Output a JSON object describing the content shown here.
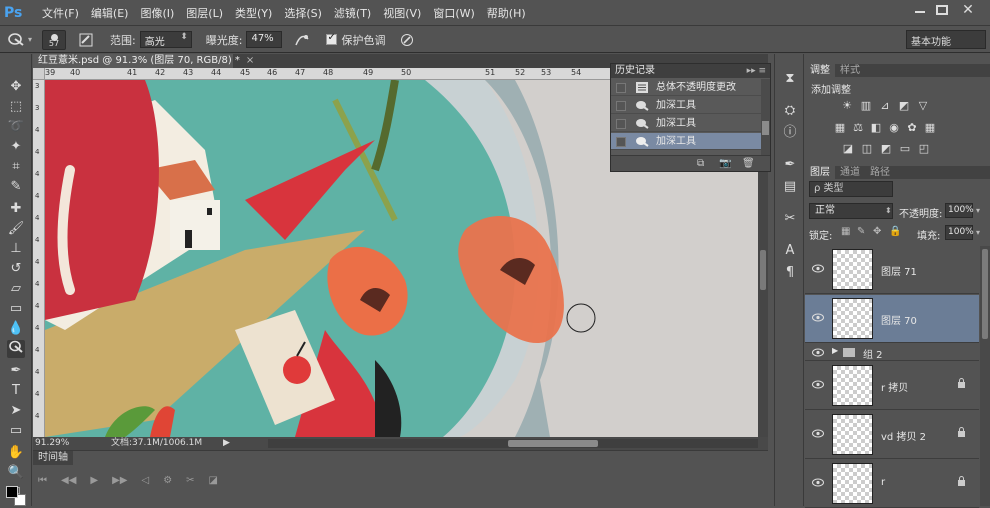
{
  "app": {
    "logo": "Ps"
  },
  "menu": [
    "文件(F)",
    "编辑(E)",
    "图像(I)",
    "图层(L)",
    "类型(Y)",
    "选择(S)",
    "滤镜(T)",
    "视图(V)",
    "窗口(W)",
    "帮助(H)"
  ],
  "options": {
    "brush_size": "57",
    "range_label": "范围:",
    "range_value": "高光",
    "exposure_label": "曝光度:",
    "exposure_value": "47%",
    "protect_tones_label": "保护色调"
  },
  "workspace": {
    "value": "基本功能"
  },
  "document": {
    "tab_title": "红豆薏米.psd @ 91.3% (图层 70, RGB/8) *",
    "ruler_h": [
      "39",
      "40",
      "41",
      "42",
      "43",
      "44",
      "45",
      "46",
      "47",
      "48",
      "49",
      "50",
      "51",
      "52",
      "53",
      "54"
    ],
    "ruler_v": [
      "3",
      "3",
      "4",
      "4",
      "4",
      "4",
      "4",
      "4",
      "4",
      "4",
      "4",
      "4",
      "4",
      "4",
      "4",
      "4"
    ],
    "zoom": "91.29%",
    "doc_info": "文档:37.1M/1006.1M"
  },
  "timeline": {
    "tab": "时间轴"
  },
  "history": {
    "title": "历史记录",
    "items": [
      {
        "label": "总体不透明度更改",
        "icon": "document-icon"
      },
      {
        "label": "加深工具",
        "icon": "burn-icon"
      },
      {
        "label": "加深工具",
        "icon": "burn-icon"
      },
      {
        "label": "加深工具",
        "icon": "burn-icon",
        "selected": true
      }
    ]
  },
  "adjustments": {
    "tabs": [
      "调整",
      "样式"
    ],
    "title": "添加调整"
  },
  "layers": {
    "tabs": [
      "图层",
      "通道",
      "路径"
    ],
    "filter_placeholder": "ρ 类型",
    "blend_mode": "正常",
    "opacity_label": "不透明度:",
    "opacity_value": "100%",
    "lock_label": "锁定:",
    "fill_label": "填充:",
    "fill_value": "100%",
    "items": [
      {
        "type": "layer",
        "name": "图层 71",
        "locked": false
      },
      {
        "type": "layer",
        "name": "图层 70",
        "locked": false,
        "selected": true
      },
      {
        "type": "group",
        "name": "组 2"
      },
      {
        "type": "layer",
        "name": "r 拷贝",
        "locked": true
      },
      {
        "type": "layer",
        "name": "vd 拷贝 2",
        "locked": true
      },
      {
        "type": "layer",
        "name": "r",
        "locked": true
      }
    ]
  },
  "colors": {
    "accent": "#4aa3f0",
    "selected_row": "#6b7d96",
    "canvas_bg": "#d2cfcc"
  }
}
